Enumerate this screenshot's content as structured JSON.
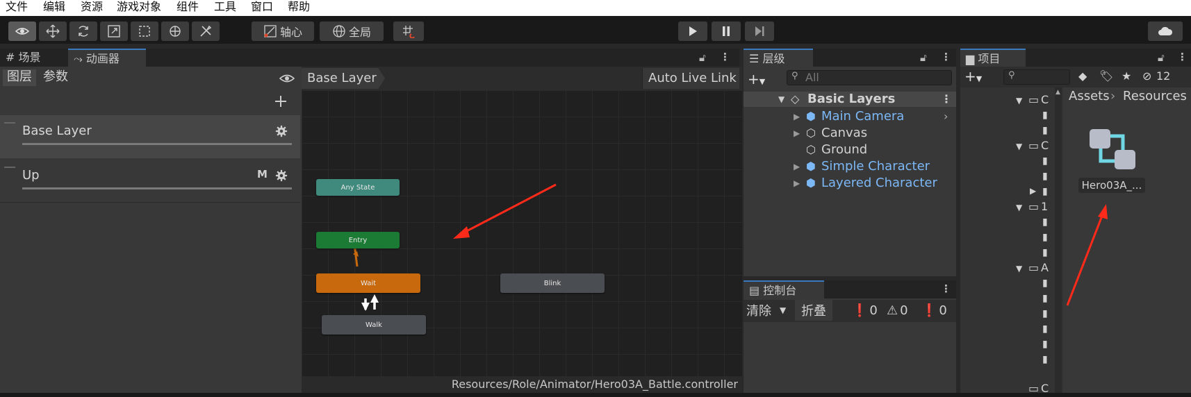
{
  "menu": [
    "文件",
    "编辑",
    "资源",
    "游戏对象",
    "组件",
    "工具",
    "窗口",
    "帮助"
  ],
  "toolbar": {
    "pivot_label": "轴心",
    "global_label": "全局"
  },
  "animator": {
    "tabs": [
      "场景",
      "动画器"
    ],
    "subtabs": [
      "图层",
      "参数"
    ],
    "breadcrumb": "Base Layer",
    "auto_live_link": "Auto Live Link",
    "layers": [
      {
        "name": "Base Layer",
        "badge": ""
      },
      {
        "name": "Up",
        "badge": "M"
      }
    ],
    "nodes": {
      "any_state": "Any State",
      "entry": "Entry",
      "wait": "Wait",
      "blink": "Blink",
      "walk": "Walk"
    },
    "footer_path": "Resources/Role/Animator/Hero03A_Battle.controller"
  },
  "hierarchy": {
    "tab": "层级",
    "search_placeholder": "All",
    "scene": "Basic Layers",
    "items": [
      "Main Camera",
      "Canvas",
      "Ground",
      "Simple Character",
      "Layered Character"
    ]
  },
  "console": {
    "tab": "控制台",
    "clear_label": "清除",
    "collapse_label": "折叠",
    "info_count": "0",
    "warning_count": "0",
    "error_count": "0"
  },
  "project": {
    "tab": "项目",
    "breadcrumb": [
      "Assets",
      "Resources"
    ],
    "hidden_count": "12",
    "asset_name": "Hero03A_...",
    "tree_letters": [
      "C",
      "C",
      "1",
      "A",
      "C"
    ]
  },
  "colors": {
    "accent": "#3a79bb",
    "entry_node": "#1b7a34",
    "any_state_node": "#3f8a7d",
    "default_node": "#c8690e",
    "annotation_arrow": "#ff2a1a",
    "prefab_text": "#7cb8f6"
  }
}
